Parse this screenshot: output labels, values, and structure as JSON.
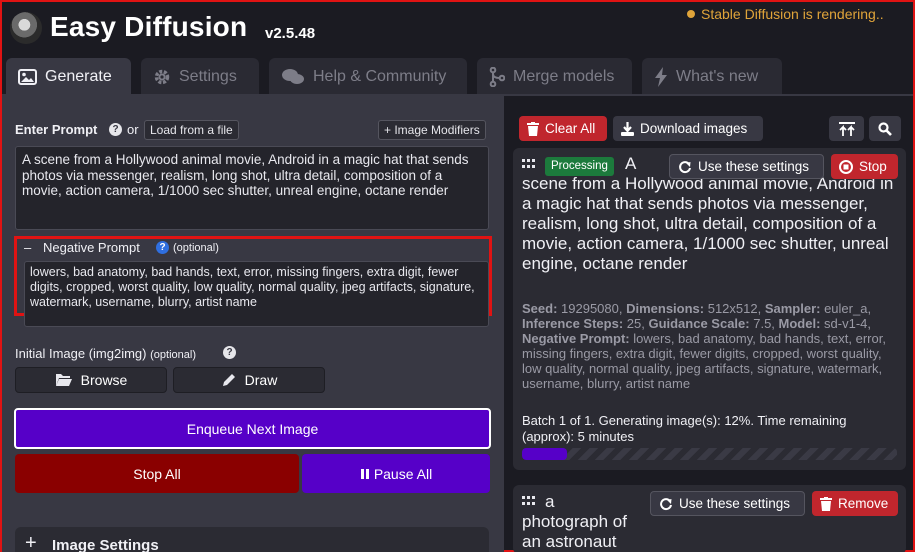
{
  "header": {
    "title": "Easy Diffusion",
    "version": "v2.5.48",
    "status": "Stable Diffusion is rendering.."
  },
  "tabs": [
    {
      "label": "Generate",
      "icon": "image-icon",
      "active": true
    },
    {
      "label": "Settings",
      "icon": "gear-icon"
    },
    {
      "label": "Help & Community",
      "icon": "comments-icon"
    },
    {
      "label": "Merge models",
      "icon": "git-merge-icon"
    },
    {
      "label": "What's new",
      "icon": "bolt-icon"
    }
  ],
  "prompt": {
    "label": "Enter Prompt",
    "or": "or",
    "load_file": "Load from a file",
    "modifiers": "+ Image Modifiers",
    "value": "A scene from a Hollywood animal movie, Android in a magic hat that sends photos via messenger, realism, long shot, ultra detail, composition of a movie, action camera, 1/1000 sec shutter, unreal engine, octane render"
  },
  "negative": {
    "collapse_symbol": "–",
    "label": "Negative Prompt",
    "optional": "(optional)",
    "value": "lowers, bad anatomy, bad hands, text, error, missing fingers, extra digit, fewer digits, cropped, worst quality, low quality, normal quality, jpeg artifacts, signature, watermark, username, blurry, artist name"
  },
  "init_image": {
    "label": "Initial Image (img2img)",
    "optional": "(optional)",
    "browse": "Browse",
    "draw": "Draw"
  },
  "actions": {
    "enqueue": "Enqueue Next Image",
    "stop_all": "Stop All",
    "pause_all": "Pause All"
  },
  "image_settings": {
    "expand_symbol": "+",
    "label": "Image Settings"
  },
  "toolbar": {
    "clear_all": "Clear All",
    "download": "Download images"
  },
  "tasks": [
    {
      "badge": "Processing",
      "prompt_first": "A",
      "prompt_rest": "scene from a Hollywood animal movie, Android in a magic hat that sends photos via messenger, realism, long shot, ultra detail, composition of a movie, action camera, 1/1000 sec shutter, unreal engine, octane render",
      "use_settings": "Use these settings",
      "stop": "Stop",
      "meta": [
        {
          "k": "Seed:",
          "v": "19295080,"
        },
        {
          "k": "Dimensions:",
          "v": "512x512,"
        },
        {
          "k": "Sampler:",
          "v": "euler_a,"
        },
        {
          "k": "Inference Steps:",
          "v": "25,"
        },
        {
          "k": "Guidance Scale:",
          "v": "7.5,"
        },
        {
          "k": "Model:",
          "v": "sd-v1-4,"
        },
        {
          "k": "Negative Prompt:",
          "v": "lowers, bad anatomy, bad hands, text, error, missing fingers, extra digit, fewer digits, cropped, worst quality, low quality, normal quality, jpeg artifacts, signature, watermark, username, blurry, artist name"
        }
      ],
      "progress_text": "Batch 1 of 1. Generating image(s): 12%. Time remaining (approx): 5 minutes",
      "progress": 0.12
    },
    {
      "prompt_first": "a",
      "prompt_rest": "photograph of an astronaut riding a horse",
      "use_settings": "Use these settings",
      "remove": "Remove"
    }
  ],
  "colors": {
    "accent_purple": "#5600c8",
    "stop_red": "#8a0000",
    "danger_red": "#c0262d",
    "highlight_border": "#e01313",
    "status_orange": "#e0a43a",
    "processing_green": "#1c7a3c"
  }
}
